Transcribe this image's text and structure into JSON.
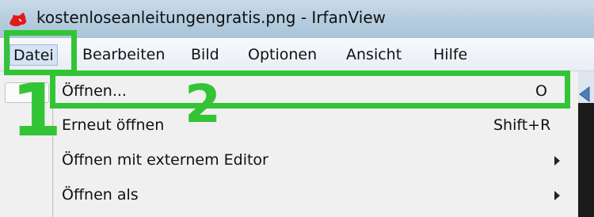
{
  "window": {
    "title": "kostenloseanleitungengratis.png - IrfanView",
    "icon": "irfanview-icon"
  },
  "menubar": {
    "items": [
      {
        "label": "Datei"
      },
      {
        "label": "Bearbeiten"
      },
      {
        "label": "Bild"
      },
      {
        "label": "Optionen"
      },
      {
        "label": "Ansicht"
      },
      {
        "label": "Hilfe"
      }
    ]
  },
  "dropdown": {
    "items": [
      {
        "label": "Öffnen...",
        "shortcut": "O"
      },
      {
        "label": "Erneut öffnen",
        "shortcut": "Shift+R"
      },
      {
        "label": "Öffnen mit externem Editor",
        "submenu": true
      },
      {
        "label": "Öffnen als",
        "submenu": true
      }
    ]
  },
  "annotations": {
    "step1": "1",
    "step2": "2",
    "color": "#33c435"
  },
  "icons": {
    "submenu": "chevron-right-icon",
    "nav": "arrow-left-icon"
  }
}
